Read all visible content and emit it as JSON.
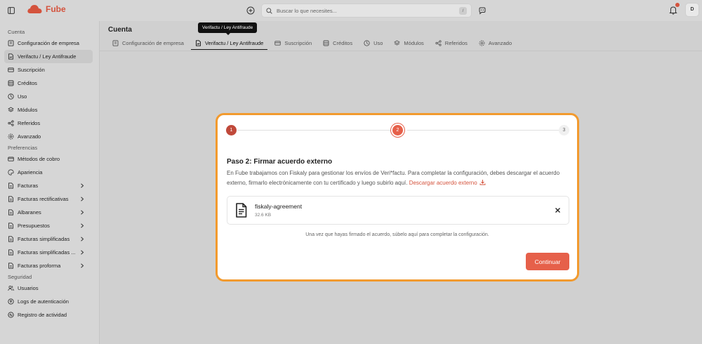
{
  "app": {
    "name": "Fube",
    "brand_color": "#d4533d",
    "accent_color": "#e6604a",
    "highlight_color": "#f29a2e"
  },
  "topbar": {
    "search": {
      "placeholder": "Buscar lo que necesites...",
      "shortcut": "/"
    },
    "user_initial": "D",
    "notification_dot": true
  },
  "sidebar": {
    "sections": [
      {
        "label": "Cuenta",
        "items": [
          {
            "label": "Configuración de empresa",
            "icon": "building-icon",
            "active": false
          },
          {
            "label": "Verifactu / Ley Antifraude",
            "icon": "file-signature-icon",
            "active": true
          },
          {
            "label": "Suscripción",
            "icon": "credit-card-icon",
            "active": false
          },
          {
            "label": "Créditos",
            "icon": "database-icon",
            "active": false
          },
          {
            "label": "Uso",
            "icon": "gauge-icon",
            "active": false
          },
          {
            "label": "Módulos",
            "icon": "layers-icon",
            "active": false
          },
          {
            "label": "Referidos",
            "icon": "share-icon",
            "active": false
          },
          {
            "label": "Avanzado",
            "icon": "gear-icon",
            "active": false
          }
        ]
      },
      {
        "label": "Preferencias",
        "items": [
          {
            "label": "Métodos de cobro",
            "icon": "wallet-icon",
            "active": false
          },
          {
            "label": "Apariencia",
            "icon": "palette-icon",
            "active": false
          },
          {
            "label": "Facturas",
            "icon": "invoice-icon",
            "active": false,
            "expandable": true
          },
          {
            "label": "Facturas rectificativas",
            "icon": "invoice-icon",
            "active": false,
            "expandable": true
          },
          {
            "label": "Albaranes",
            "icon": "invoice-icon",
            "active": false,
            "expandable": true
          },
          {
            "label": "Presupuestos",
            "icon": "invoice-icon",
            "active": false,
            "expandable": true
          },
          {
            "label": "Facturas simplificadas",
            "icon": "invoice-icon",
            "active": false,
            "expandable": true
          },
          {
            "label": "Facturas simplificadas ...",
            "icon": "invoice-icon",
            "active": false,
            "expandable": true
          },
          {
            "label": "Facturas proforma",
            "icon": "invoice-icon",
            "active": false,
            "expandable": true
          }
        ]
      },
      {
        "label": "Seguridad",
        "items": [
          {
            "label": "Usuarios",
            "icon": "users-icon",
            "active": false
          },
          {
            "label": "Logs de autenticación",
            "icon": "key-icon",
            "active": false
          },
          {
            "label": "Registro de actividad",
            "icon": "activity-icon",
            "active": false
          }
        ]
      }
    ]
  },
  "main": {
    "title": "Cuenta",
    "tooltip": "Verifactu / Ley Antifraude",
    "tabs": [
      {
        "label": "Configuración de empresa",
        "icon": "building-icon",
        "active": false
      },
      {
        "label": "Verifactu / Ley Antifraude",
        "icon": "file-signature-icon",
        "active": true
      },
      {
        "label": "Suscripción",
        "icon": "credit-card-icon",
        "active": false
      },
      {
        "label": "Créditos",
        "icon": "database-icon",
        "active": false
      },
      {
        "label": "Uso",
        "icon": "gauge-icon",
        "active": false
      },
      {
        "label": "Módulos",
        "icon": "layers-icon",
        "active": false
      },
      {
        "label": "Referidos",
        "icon": "share-icon",
        "active": false
      },
      {
        "label": "Avanzado",
        "icon": "gear-icon",
        "active": false
      }
    ]
  },
  "dialog": {
    "steps": [
      {
        "label": "1",
        "state": "done"
      },
      {
        "label": "2",
        "state": "current"
      },
      {
        "label": "3",
        "state": "todo"
      }
    ],
    "title": "Paso 2: Firmar acuerdo externo",
    "description": "En Fube trabajamos con Fiskaly para gestionar los envíos de Veri*factu. Para completar la configuración, debes descargar el acuerdo externo, firmarlo electrónicamente con tu certificado y luego subirlo aquí.",
    "download_link": "Descargar acuerdo externo",
    "file": {
      "name": "fiskaly-agreement",
      "size": "32.6 KB"
    },
    "hint": "Una vez que hayas firmado el acuerdo, súbelo aquí para completar la configuración.",
    "continue_label": "Continuar"
  }
}
